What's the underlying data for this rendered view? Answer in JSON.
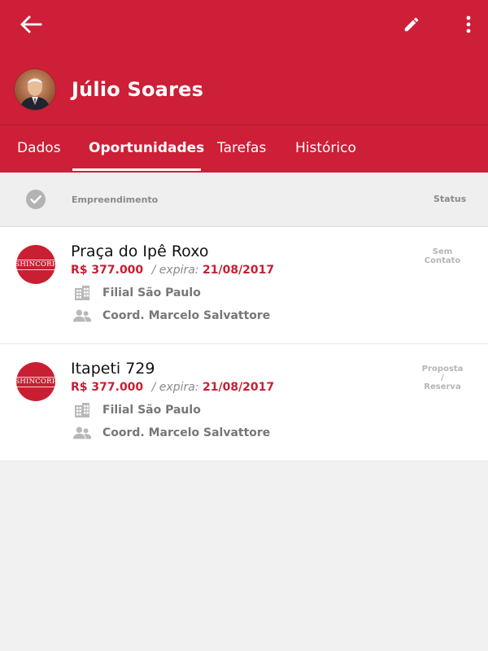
{
  "header": {
    "person_name": "Júlio Soares",
    "color": "#cd1f37"
  },
  "tabs": [
    {
      "label": "Dados",
      "active": false
    },
    {
      "label": "Oportunidades",
      "active": true
    },
    {
      "label": "Tarefas",
      "active": false
    },
    {
      "label": "Histórico",
      "active": false
    }
  ],
  "columns": {
    "empreendimento": "Empreendimento",
    "status": "Status"
  },
  "cards": [
    {
      "logo_text": "SHINCORP",
      "title": "Praça do Ipê Roxo",
      "price": "R$ 377.000",
      "expira_label": "/ expira:",
      "date": "21/08/2017",
      "filial": "Filial São Paulo",
      "coord": "Coord. Marcelo Salvattore",
      "status_line1": "Sem",
      "status_line2": "Contato"
    },
    {
      "logo_text": "SHINCORP",
      "title": "Itapeti 729",
      "price": "R$ 377.000",
      "expira_label": "/ expira:",
      "date": "21/08/2017",
      "filial": "Filial São Paulo",
      "coord": "Coord. Marcelo Salvattore",
      "status_line1": "Proposta",
      "status_line2": "/ Reserva"
    }
  ],
  "icons": {
    "back": "arrow-back-icon",
    "edit": "pencil-icon",
    "more": "more-vertical-icon",
    "check": "check-circle-icon",
    "building": "building-icon",
    "people": "people-icon"
  }
}
